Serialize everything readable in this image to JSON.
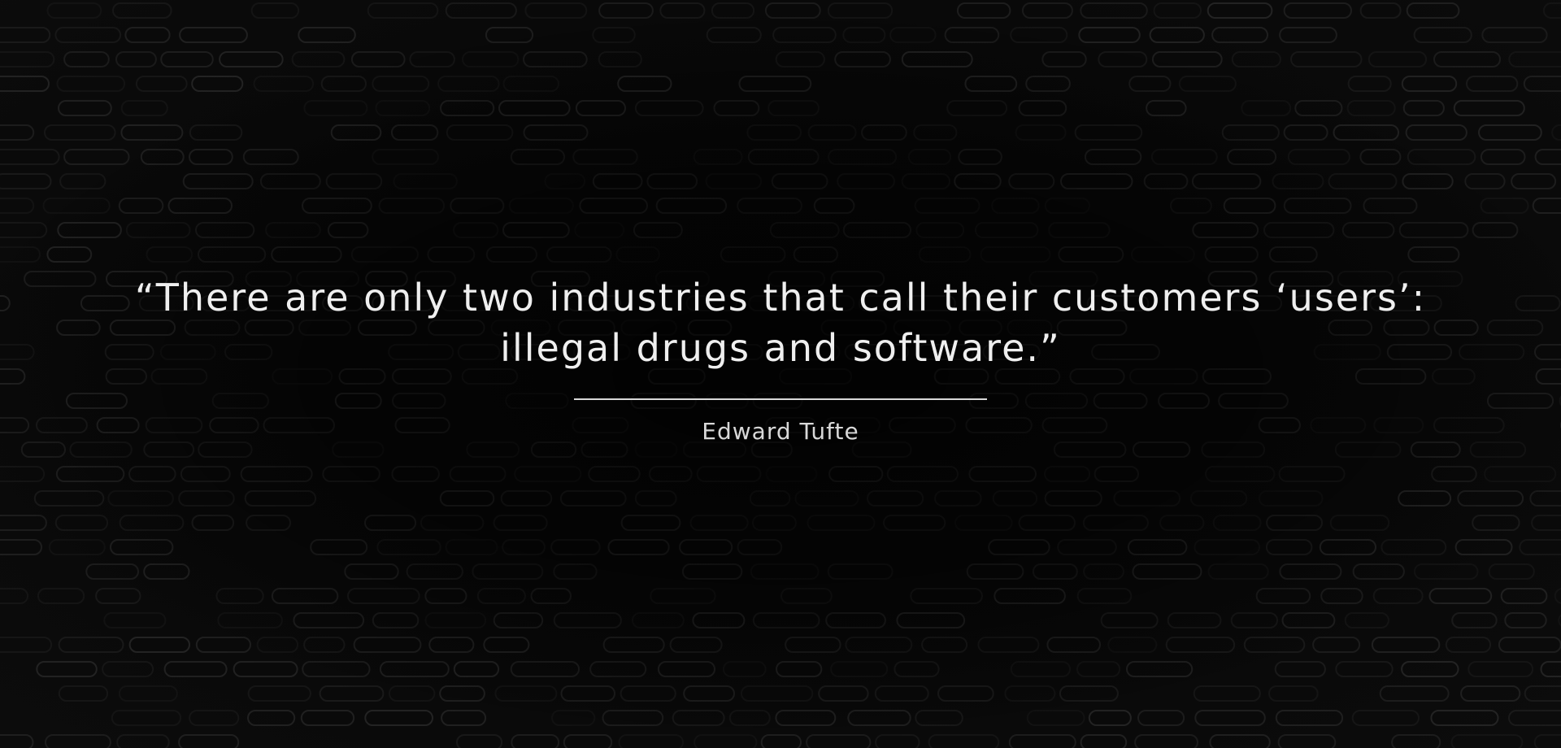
{
  "quote": {
    "text": "“There are only two industries that call their customers ‘users’: illegal drugs and software.”",
    "author": "Edward Tufte"
  },
  "colors": {
    "background": "#050505",
    "text": "#efefef",
    "pattern_pill": "#2a2a2a"
  }
}
